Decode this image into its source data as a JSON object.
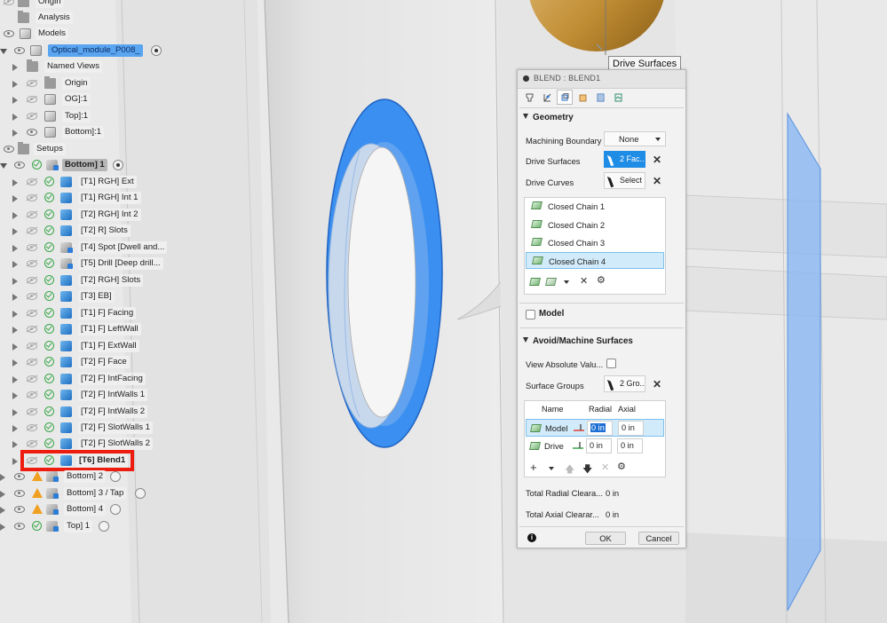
{
  "tooltip": "Drive Surfaces",
  "browser": {
    "rows": [
      {
        "label": "Origin"
      },
      {
        "label": "Analysis"
      },
      {
        "label": "Models"
      },
      {
        "label": "Optical_module_P008_"
      },
      {
        "label": "Named Views"
      },
      {
        "label": "Origin"
      },
      {
        "label": "OG]:1"
      },
      {
        "label": "Top]:1"
      },
      {
        "label": "Bottom]:1"
      },
      {
        "label": "Setups"
      },
      {
        "label": "Bottom] 1"
      },
      {
        "label": "[T1] RGH] Ext"
      },
      {
        "label": "[T1] RGH] Int 1"
      },
      {
        "label": "[T2] RGH] Int 2"
      },
      {
        "label": "[T2] R] Slots"
      },
      {
        "label": "[T4] Spot [Dwell and..."
      },
      {
        "label": "[T5] Drill [Deep drill..."
      },
      {
        "label": "[T2] RGH] Slots"
      },
      {
        "label": "[T3] EB]"
      },
      {
        "label": "[T1] F] Facing"
      },
      {
        "label": "[T1] F] LeftWall"
      },
      {
        "label": "[T1] F] ExtWall"
      },
      {
        "label": "[T2] F] Face"
      },
      {
        "label": "[T2] F] IntFacing"
      },
      {
        "label": "[T2] F] IntWalls 1"
      },
      {
        "label": "[T2] F] IntWalls 2"
      },
      {
        "label": "[T2] F] SlotWalls 1"
      },
      {
        "label": "[T2] F] SlotWalls 2"
      },
      {
        "label": "[T6] Blend1"
      },
      {
        "label": "Bottom] 2"
      },
      {
        "label": "Bottom] 3 / Tap"
      },
      {
        "label": "Bottom] 4"
      },
      {
        "label": "Top] 1"
      }
    ]
  },
  "dialog": {
    "title": "BLEND : BLEND1",
    "tab_icons": [
      "tool-icon",
      "geometry-icon",
      "heights-icon",
      "passes-icon",
      "linking-icon",
      "simulation-icon"
    ],
    "geometry": {
      "header": "Geometry",
      "machining_boundary_label": "Machining Boundary",
      "machining_boundary_value": "None",
      "drive_surfaces_label": "Drive Surfaces",
      "drive_surfaces_value": "2 Fac...",
      "drive_curves_label": "Drive Curves",
      "drive_curves_value": "Select",
      "chains": [
        "Closed Chain 1",
        "Closed Chain 2",
        "Closed Chain 3",
        "Closed Chain 4"
      ]
    },
    "model": {
      "header": "Model"
    },
    "avoid": {
      "header": "Avoid/Machine Surfaces",
      "view_absolute_label": "View Absolute Valu...",
      "surface_groups_label": "Surface Groups",
      "surface_groups_value": "2 Gro...",
      "columns": [
        "Name",
        "Radial",
        "Axial"
      ],
      "rows": [
        {
          "name": "Model",
          "radial": "0 in",
          "axial": "0 in"
        },
        {
          "name": "Drive",
          "radial": "0 in",
          "axial": "0 in"
        }
      ],
      "total_radial_label": "Total Radial Cleara...",
      "total_radial_value": "0 in",
      "total_axial_label": "Total Axial Clearar...",
      "total_axial_value": "0 in"
    },
    "ok_label": "OK",
    "cancel_label": "Cancel",
    "info_glyph": "i"
  },
  "colors": {
    "accent": "#1f8ce6",
    "selection": "#5aa5f0",
    "highlight_box": "#ee1c0f",
    "part_blue": "#3b8ff0",
    "warning": "#f0a020",
    "ok_green": "#3aa74a"
  }
}
